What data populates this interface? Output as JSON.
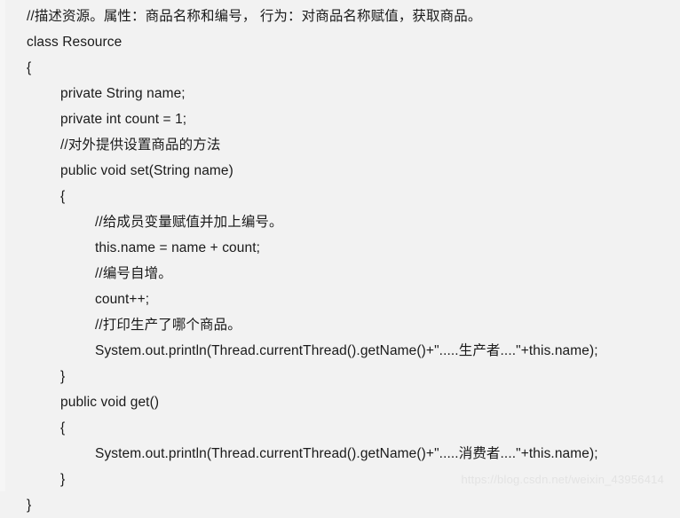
{
  "document": {
    "background_color": "#f2f2f2",
    "text_color": "#1a1a1a",
    "language": "java",
    "watermark": "https://blog.csdn.net/weixin_43956414",
    "watermark_color": "#e3e3e3"
  },
  "code": {
    "lines": [
      {
        "indent": 0,
        "text": "//描述资源。属性：商品名称和编号， 行为：对商品名称赋值，获取商品。"
      },
      {
        "indent": 0,
        "text": "class Resource"
      },
      {
        "indent": 0,
        "text": "{"
      },
      {
        "indent": 1,
        "text": "private String name;"
      },
      {
        "indent": 1,
        "text": "private int count = 1;"
      },
      {
        "indent": 1,
        "text": "//对外提供设置商品的方法"
      },
      {
        "indent": 1,
        "text": "public void set(String name)"
      },
      {
        "indent": 1,
        "text": "{"
      },
      {
        "indent": 2,
        "text": "//给成员变量赋值并加上编号。"
      },
      {
        "indent": 2,
        "text": "this.name = name + count;"
      },
      {
        "indent": 2,
        "text": "//编号自增。"
      },
      {
        "indent": 2,
        "text": "count++;"
      },
      {
        "indent": 2,
        "text": "//打印生产了哪个商品。"
      },
      {
        "indent": 2,
        "text": "System.out.println(Thread.currentThread().getName()+\".....生产者....\"+this.name);"
      },
      {
        "indent": 1,
        "text": "}"
      },
      {
        "indent": 1,
        "text": "public void get()"
      },
      {
        "indent": 1,
        "text": "{"
      },
      {
        "indent": 2,
        "text": "System.out.println(Thread.currentThread().getName()+\".....消费者....\"+this.name);"
      },
      {
        "indent": 1,
        "text": "}"
      },
      {
        "indent": 0,
        "text": "}"
      }
    ]
  }
}
